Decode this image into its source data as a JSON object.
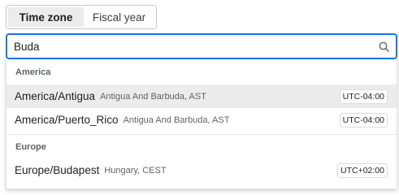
{
  "tabs": [
    {
      "label": "Time zone",
      "active": true
    },
    {
      "label": "Fiscal year",
      "active": false
    }
  ],
  "search": {
    "value": "Buda",
    "placeholder": "",
    "icon": "search-icon"
  },
  "groups": [
    {
      "label": "America",
      "options": [
        {
          "name": "America/Antigua",
          "description": "Antigua And Barbuda, AST",
          "offset": "UTC-04:00",
          "highlighted": true
        },
        {
          "name": "America/Puerto_Rico",
          "description": "Antigua And Barbuda, AST",
          "offset": "UTC-04:00",
          "highlighted": false
        }
      ]
    },
    {
      "label": "Europe",
      "options": [
        {
          "name": "Europe/Budapest",
          "description": "Hungary, CEST",
          "offset": "UTC+02:00",
          "highlighted": false
        }
      ]
    }
  ],
  "colors": {
    "focus_border": "#1a73e8",
    "highlight_bg": "#ececec",
    "active_tab_bg": "#ececec"
  }
}
